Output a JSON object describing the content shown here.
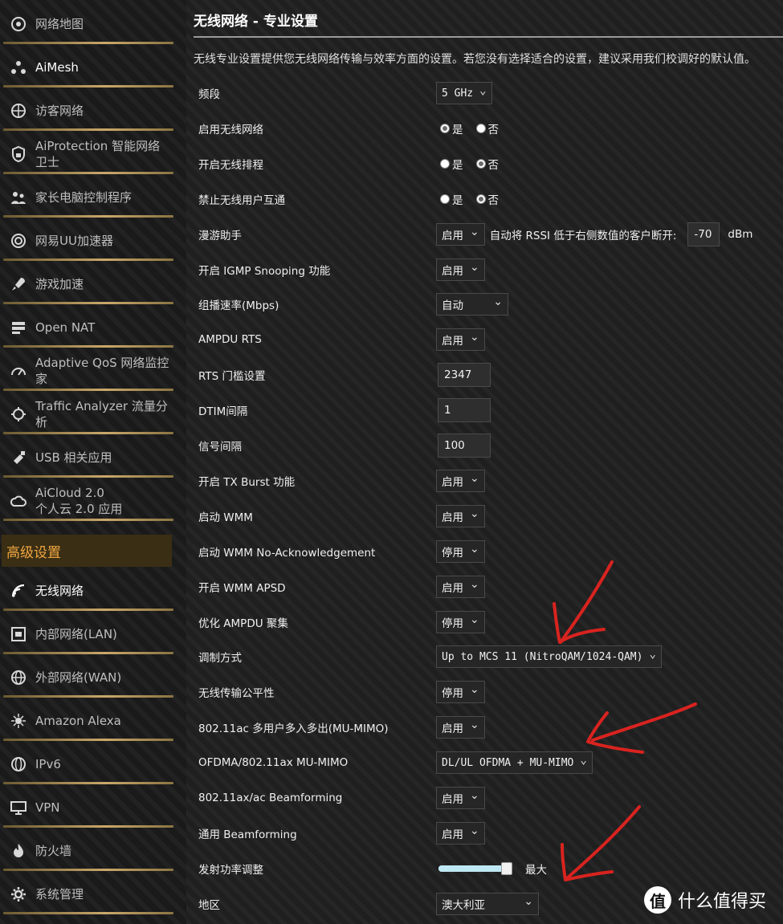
{
  "sidebar": {
    "items": [
      {
        "label": "网络地图",
        "icon": "network-map-icon"
      },
      {
        "label": "AiMesh",
        "icon": "aimesh-icon"
      },
      {
        "label": "访客网络",
        "icon": "guest-network-icon"
      },
      {
        "label": "AiProtection 智能网络卫士",
        "icon": "shield-lock-icon"
      },
      {
        "label": "家长电脑控制程序",
        "icon": "parental-control-icon"
      },
      {
        "label": "网易UU加速器",
        "icon": "uu-accelerator-icon"
      },
      {
        "label": "游戏加速",
        "icon": "rocket-icon"
      },
      {
        "label": "Open NAT",
        "icon": "open-nat-icon"
      },
      {
        "label": "Adaptive QoS 网络监控家",
        "icon": "speedometer-icon"
      },
      {
        "label": "Traffic Analyzer 流量分析",
        "icon": "traffic-analyzer-icon"
      },
      {
        "label": "USB 相关应用",
        "icon": "usb-icon"
      },
      {
        "label": "AiCloud 2.0\n个人云 2.0 应用",
        "icon": "cloud-icon"
      }
    ],
    "section_title": "高级设置",
    "adv_items": [
      {
        "label": "无线网络",
        "icon": "wireless-icon"
      },
      {
        "label": "内部网络(LAN)",
        "icon": "lan-icon"
      },
      {
        "label": "外部网络(WAN)",
        "icon": "globe-icon"
      },
      {
        "label": "Amazon Alexa",
        "icon": "alexa-icon"
      },
      {
        "label": "IPv6",
        "icon": "ipv6-globe-icon"
      },
      {
        "label": "VPN",
        "icon": "vpn-icon"
      },
      {
        "label": "防火墙",
        "icon": "firewall-icon"
      },
      {
        "label": "系统管理",
        "icon": "gear-icon"
      }
    ]
  },
  "main": {
    "title": "无线网络 - 专业设置",
    "description": "无线专业设置提供您无线网络传输与效率方面的设置。若您没有选择适合的设置，建议采用我们校调好的默认值。",
    "rows": [
      {
        "label": "频段",
        "type": "select",
        "value": "5 GHz",
        "mono": true
      },
      {
        "label": "启用无线网络",
        "type": "radio",
        "yes": "是",
        "no": "否",
        "selected": "yes"
      },
      {
        "label": "开启无线排程",
        "type": "radio",
        "yes": "是",
        "no": "否",
        "selected": "no"
      },
      {
        "label": "禁止无线用户互通",
        "type": "radio",
        "yes": "是",
        "no": "否",
        "selected": "no"
      },
      {
        "label": "漫游助手",
        "type": "roaming",
        "value": "启用",
        "text": "自动将 RSSI 低于右侧数值的客户断开:",
        "input": "-70",
        "unit": "dBm"
      },
      {
        "label": "开启 IGMP Snooping 功能",
        "type": "select",
        "value": "启用"
      },
      {
        "label": "组播速率(Mbps)",
        "type": "select",
        "value": "自动",
        "wide": true
      },
      {
        "label": "AMPDU RTS",
        "type": "select",
        "value": "启用"
      },
      {
        "label": "RTS 门槛设置",
        "type": "input",
        "value": "2347"
      },
      {
        "label": "DTIM间隔",
        "type": "input",
        "value": "1"
      },
      {
        "label": "信号间隔",
        "type": "input",
        "value": "100"
      },
      {
        "label": "开启 TX Burst 功能",
        "type": "select",
        "value": "启用"
      },
      {
        "label": "启动 WMM",
        "type": "select",
        "value": "启用"
      },
      {
        "label": "启动 WMM No-Acknowledgement",
        "type": "select",
        "value": "停用"
      },
      {
        "label": "开启 WMM APSD",
        "type": "select",
        "value": "启用"
      },
      {
        "label": "优化 AMPDU 聚集",
        "type": "select",
        "value": "停用"
      },
      {
        "label": "调制方式",
        "type": "select",
        "value": "Up to MCS 11 (NitroQAM/1024-QAM)",
        "mono": true
      },
      {
        "label": "无线传输公平性",
        "type": "select",
        "value": "停用"
      },
      {
        "label": "802.11ac 多用户多入多出(MU-MIMO)",
        "type": "select",
        "value": "启用"
      },
      {
        "label": "OFDMA/802.11ax MU-MIMO",
        "type": "select",
        "value": "DL/UL OFDMA + MU-MIMO",
        "mono": true
      },
      {
        "label": "802.11ax/ac Beamforming",
        "type": "select",
        "value": "启用"
      },
      {
        "label": "通用 Beamforming",
        "type": "select",
        "value": "启用"
      },
      {
        "label": "发射功率调整",
        "type": "slider",
        "level": 1.0,
        "text": "最大"
      },
      {
        "label": "地区",
        "type": "select",
        "value": "澳大利亚",
        "wide2": true
      }
    ]
  },
  "watermark": {
    "logo": "值",
    "text": "什么值得买"
  },
  "colors": {
    "accent": "#f0a640",
    "annotation": "#d9231f",
    "rule": "#caa86a"
  }
}
